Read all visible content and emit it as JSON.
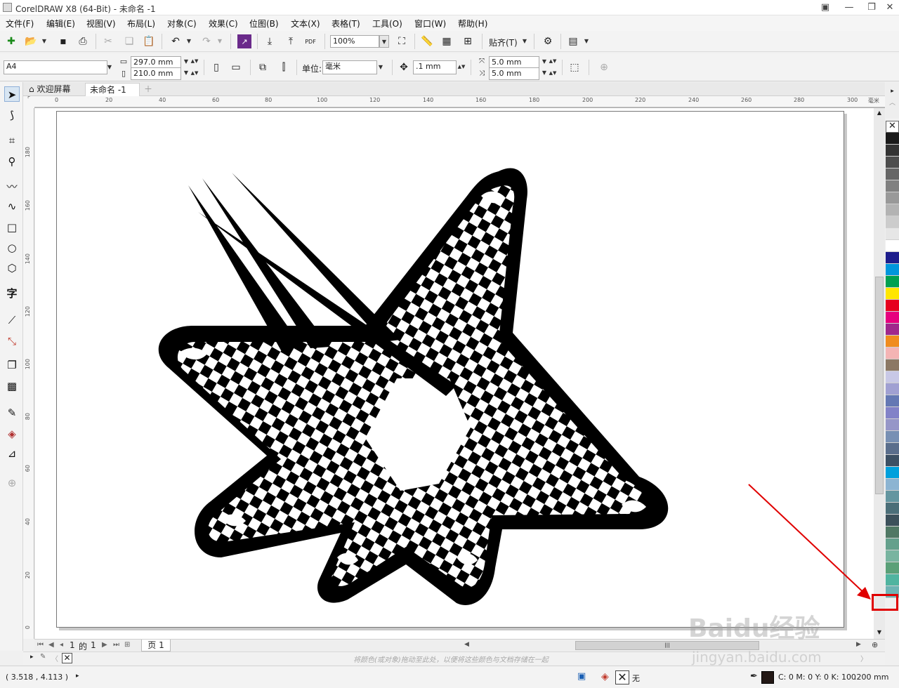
{
  "window": {
    "title": "CorelDRAW X8 (64-Bit) - 未命名 -1"
  },
  "menu": [
    "文件(F)",
    "编辑(E)",
    "视图(V)",
    "布局(L)",
    "对象(C)",
    "效果(C)",
    "位图(B)",
    "文本(X)",
    "表格(T)",
    "工具(O)",
    "窗口(W)",
    "帮助(H)"
  ],
  "toolbar": {
    "zoom": "100%",
    "snap_label": "贴齐(T)",
    "pdf_label": "PDF"
  },
  "property_bar": {
    "page_size": "A4",
    "width": "297.0 mm",
    "height": "210.0 mm",
    "unit_label": "单位:",
    "unit_value": "毫米",
    "nudge": ".1 mm",
    "dup_x": "5.0 mm",
    "dup_y": "5.0 mm"
  },
  "tabs": {
    "welcome": "欢迎屏幕",
    "document": "未命名 -1"
  },
  "ruler": {
    "unit": "毫米",
    "h_labels": [
      "0",
      "20",
      "40",
      "60",
      "80",
      "100",
      "120",
      "140",
      "160",
      "180",
      "200",
      "220",
      "240",
      "260",
      "280",
      "300"
    ],
    "v_labels": [
      "180",
      "160",
      "140",
      "120",
      "100",
      "80",
      "60",
      "40",
      "20",
      "0"
    ]
  },
  "page_nav": {
    "current": "1",
    "of": "的",
    "total": "1",
    "page_tab": "页 1"
  },
  "doc_palette_hint": "将颜色(或对象)拖动至此处，以便将这些颜色与文档存储在一起",
  "status": {
    "coords": "( 3.518 , 4.113 )",
    "fill_label": "无",
    "outline_color": "C: 0 M: 0 Y: 0 K: 100",
    "outline_width": ".200 mm"
  },
  "palette_colors": [
    "#1a1a1a",
    "#333333",
    "#4d4d4d",
    "#666666",
    "#808080",
    "#999999",
    "#b3b3b3",
    "#cccccc",
    "#e6e6e6",
    "#ffffff",
    "#1d1d8c",
    "#0096dc",
    "#00a050",
    "#ffe600",
    "#e6001e",
    "#e6007e",
    "#a0288c",
    "#f08c1e",
    "#f4b4b4",
    "#8c7864",
    "#c8c8e6",
    "#a0a0d2",
    "#6478b4",
    "#8282c8",
    "#9696c8",
    "#7890b4",
    "#5a6e8c",
    "#3c5064",
    "#00a0dc",
    "#8cb4d2",
    "#6496a0",
    "#4b6e78",
    "#3c505a",
    "#507864",
    "#64a08c",
    "#78b4a0",
    "#5aa078",
    "#50b4a0",
    "#6eb4b4"
  ],
  "watermark": {
    "main": "Baidu经验",
    "sub": "jingyan.baidu.com"
  }
}
